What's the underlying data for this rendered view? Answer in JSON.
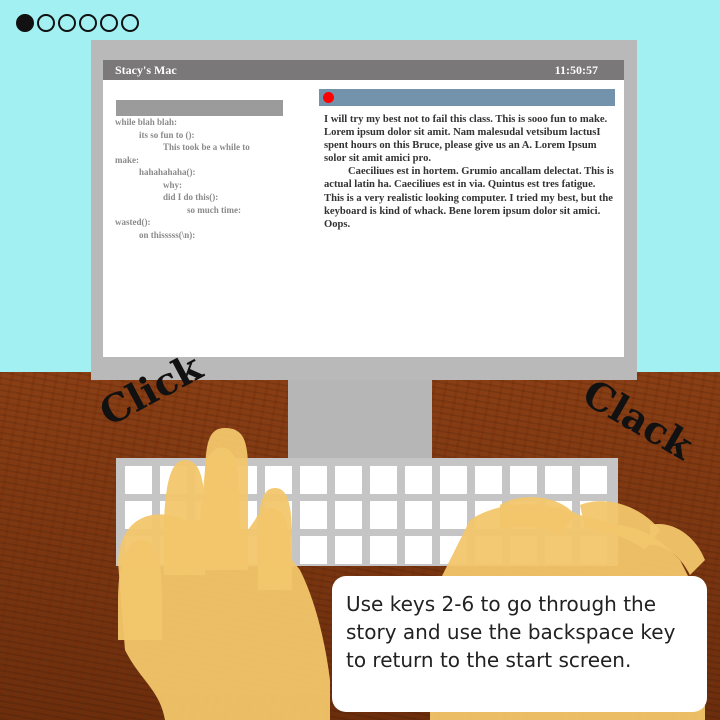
{
  "progress": {
    "total": 6,
    "current": 1
  },
  "monitor": {
    "title": "Stacy's Mac",
    "clock": "11:50:57",
    "code_lines": [
      {
        "text": "while blah blah:",
        "indent": 0
      },
      {
        "text": "its so fun to ():",
        "indent": 1
      },
      {
        "text": "This took be a while to",
        "indent": 2
      },
      {
        "text": "make:",
        "indent": 0
      },
      {
        "text": "hahahahaha():",
        "indent": 1
      },
      {
        "text": "why:",
        "indent": 2
      },
      {
        "text": "did I do this():",
        "indent": 2
      },
      {
        "text": "so much time:",
        "indent": 3
      },
      {
        "text": "wasted():",
        "indent": 0
      },
      {
        "text": "on thisssss(\\n):",
        "indent": 1
      }
    ],
    "document": {
      "paragraph_1": "I will  try my best not to fail this class. This is sooo fun to make. Lorem ipsum dolor sit amit. Nam malesudal vetsibum lactusI spent hours on this Bruce, please give us an A. Lorem Ipsum solor sit amit amici pro.",
      "paragraph_2": "Caeciliues est in hortem. Grumio ancallam delectat. This is actual latin ha. Caeciliues est in via. Quintus est tres fatigue. This is a very realistic looking computer. I tried my best, but the keyboard is kind of whack. Bene lorem ipsum dolor sit amici. Oops."
    }
  },
  "sound_effects": {
    "left": "Click",
    "right": "Clack"
  },
  "instructions": "Use keys 2-6 to go through the story and use the backspace key to return to the start screen.",
  "colors": {
    "sky": "#a2f0f2",
    "desk": "#7a3510",
    "skin": "#f2c66b",
    "record": "#ff0000"
  }
}
